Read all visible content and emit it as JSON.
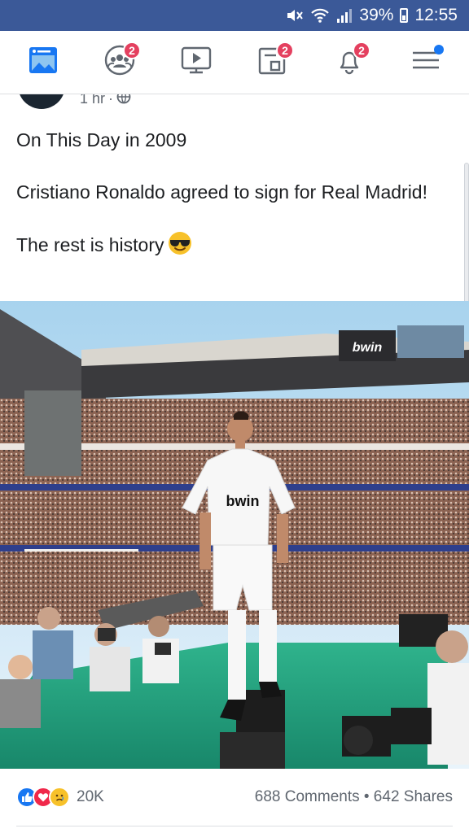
{
  "status_bar": {
    "battery": "39%",
    "time": "12:55",
    "icons": [
      "mute-icon",
      "wifi-icon",
      "signal-icon",
      "battery-icon"
    ],
    "background": "#3b5998"
  },
  "nav": {
    "items": [
      {
        "name": "news-feed",
        "icon": "news-feed-icon",
        "badge": ""
      },
      {
        "name": "friends",
        "icon": "friends-icon",
        "badge": "2"
      },
      {
        "name": "watch",
        "icon": "watch-icon",
        "badge": ""
      },
      {
        "name": "pages",
        "icon": "pages-icon",
        "badge": "2"
      },
      {
        "name": "notifications",
        "icon": "bell-icon",
        "badge": "2"
      },
      {
        "name": "menu",
        "icon": "hamburger-menu-icon",
        "badge": ""
      }
    ],
    "accent": "#1877f2",
    "badge_color": "#e4405f"
  },
  "post": {
    "time": "1 hr",
    "privacy_icon": "globe-icon",
    "text": {
      "line1": "On This Day in 2009",
      "line2": "Cristiano Ronaldo agreed to sign for Real Madrid!",
      "line3": "The rest is history",
      "emoji": "sunglasses-emoji"
    },
    "photo": {
      "description_icon": "stadium-photo",
      "sponsor_board": "bwin",
      "shirt_sponsor": "bwin"
    }
  },
  "reactions": {
    "types": [
      "like-icon",
      "love-icon",
      "sad-icon"
    ],
    "count": "20K",
    "comments_shares": "688 Comments • 642 Shares"
  }
}
